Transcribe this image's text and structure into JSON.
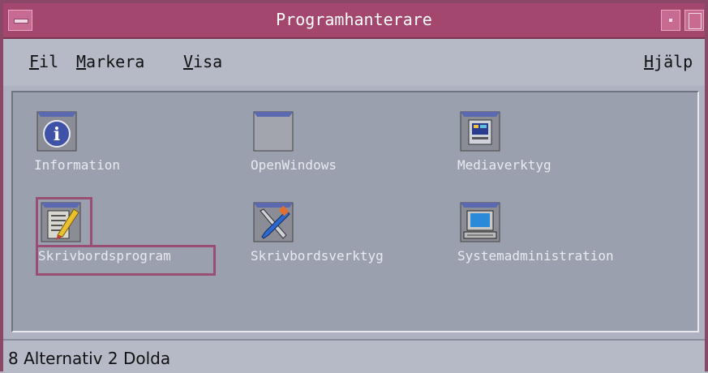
{
  "window": {
    "title": "Programhanterare"
  },
  "menubar": {
    "items": [
      {
        "mnemonic": "F",
        "rest": "il"
      },
      {
        "mnemonic": "M",
        "rest": "arkera"
      },
      {
        "mnemonic": "V",
        "rest": "isa"
      }
    ],
    "help": {
      "pre": "H",
      "mnemonic": "j",
      "rest": "älp"
    }
  },
  "icons": [
    {
      "label": "Information",
      "icon": "information-icon",
      "selected": false
    },
    {
      "label": "OpenWindows",
      "icon": "folder-icon",
      "selected": false
    },
    {
      "label": "Mediaverktyg",
      "icon": "media-tools-icon",
      "selected": false
    },
    {
      "label": "Skrivbordsprogram",
      "icon": "desktop-apps-icon",
      "selected": true
    },
    {
      "label": "Skrivbordsverktyg",
      "icon": "desktop-tools-icon",
      "selected": false
    },
    {
      "label": "Systemadministration",
      "icon": "system-admin-icon",
      "selected": false
    }
  ],
  "status": {
    "text": "8 Alternativ 2 Dolda"
  },
  "colors": {
    "title_bar": "#a3476e",
    "panel": "#9aa0ae",
    "selection": "#9b4e73"
  }
}
